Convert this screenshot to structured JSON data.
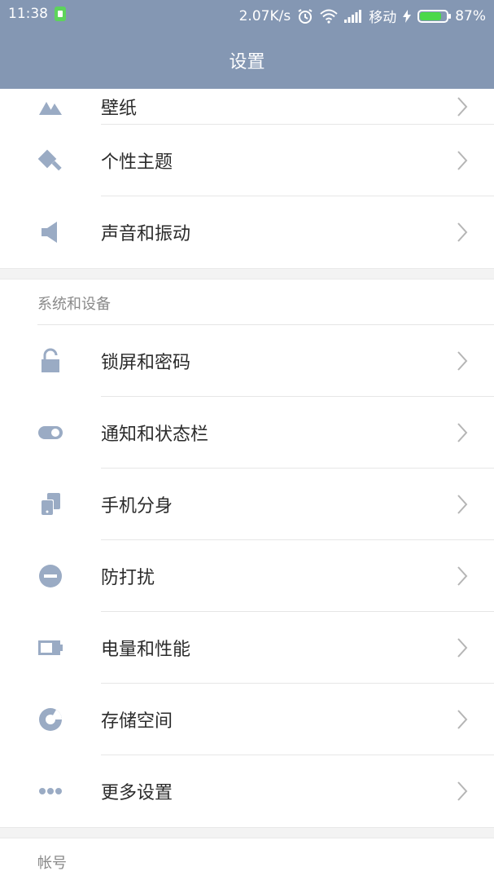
{
  "status_bar": {
    "time": "11:38",
    "speed": "2.07K/s",
    "carrier": "移动",
    "battery_percent": "87%",
    "battery_level": 0.87
  },
  "header": {
    "title": "设置"
  },
  "items_top": [
    {
      "label": "壁纸",
      "icon": "wallpaper-icon"
    },
    {
      "label": "个性主题",
      "icon": "theme-brush-icon"
    },
    {
      "label": "声音和振动",
      "icon": "speaker-icon"
    }
  ],
  "section_system": {
    "title": "系统和设备",
    "items": [
      {
        "label": "锁屏和密码",
        "icon": "lock-icon"
      },
      {
        "label": "通知和状态栏",
        "icon": "toggle-icon"
      },
      {
        "label": "手机分身",
        "icon": "dual-phone-icon"
      },
      {
        "label": "防打扰",
        "icon": "do-not-disturb-icon"
      },
      {
        "label": "电量和性能",
        "icon": "battery-icon"
      },
      {
        "label": "存储空间",
        "icon": "storage-pie-icon"
      },
      {
        "label": "更多设置",
        "icon": "more-dots-icon"
      }
    ]
  },
  "section_account": {
    "title": "帐号"
  },
  "colors": {
    "header_bg": "#8497b3",
    "icon": "#9aabc4",
    "chevron": "#b5b5b5"
  }
}
